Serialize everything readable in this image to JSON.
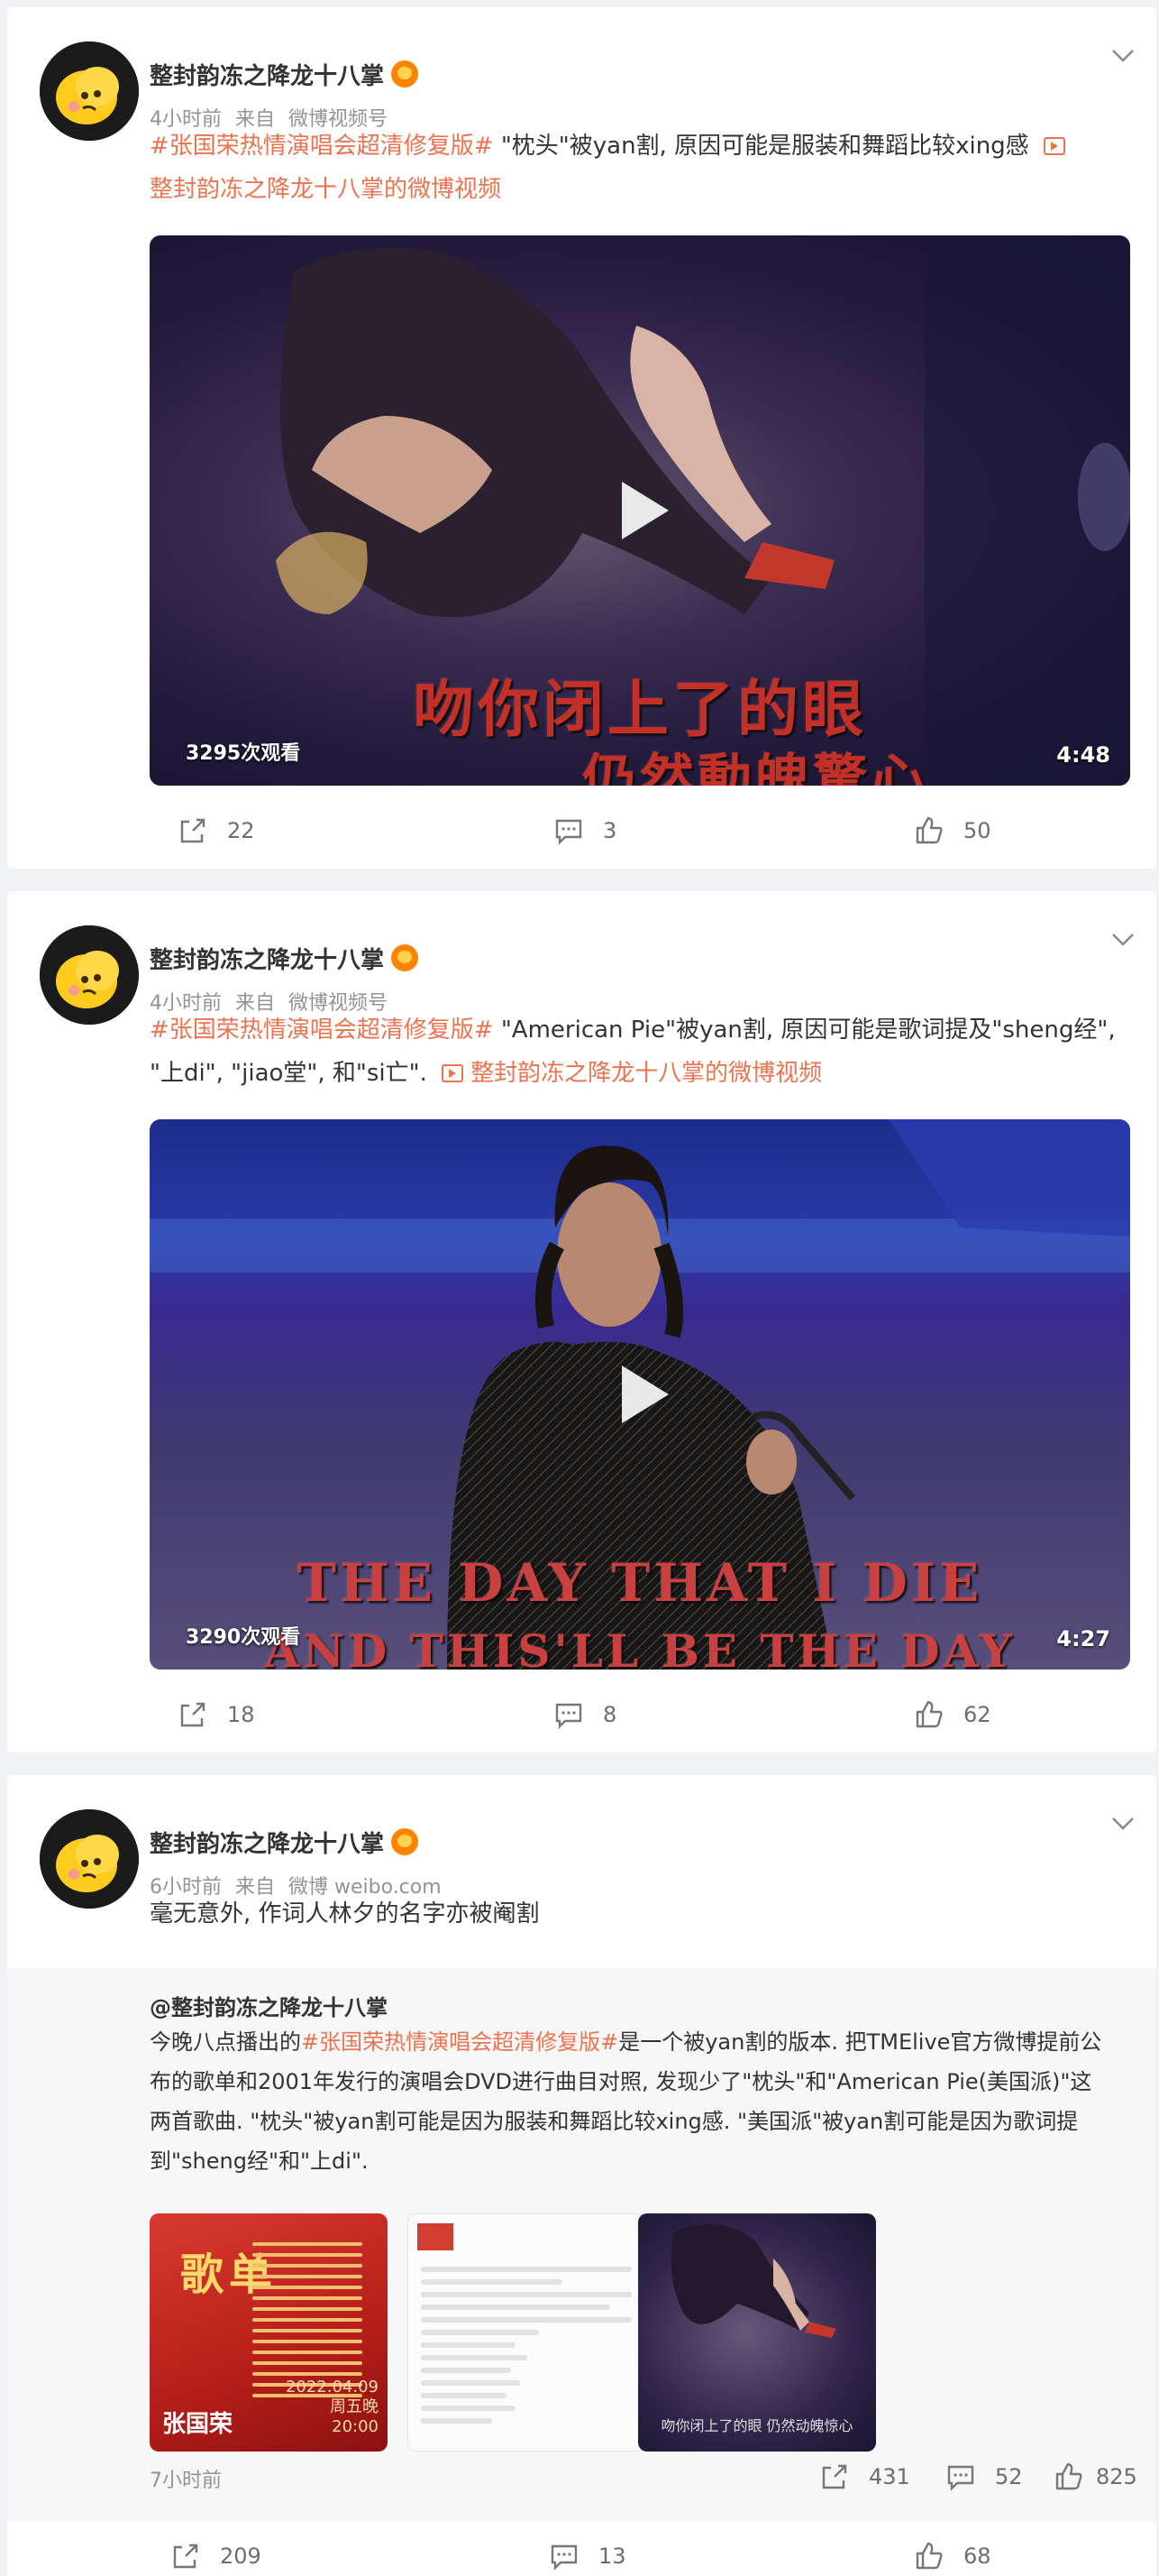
{
  "posts": [
    {
      "username": "整封韵冻之降龙十八掌",
      "time": "4小时前",
      "source_prefix": "来自",
      "source": "微博视频号",
      "hashtag": "#张国荣热情演唱会超清修复版#",
      "text": " \"枕头\"被yan割, 原因可能是服装和舞蹈比较xing感 ",
      "video_link": "整封韵冻之降龙十八掌的微博视频",
      "video": {
        "views": "3295次观看",
        "duration": "4:48",
        "subtitle_line1": "吻你闭上了的眼",
        "subtitle_line2": "仍然動魄驚心"
      },
      "actions": {
        "repost": "22",
        "comment": "3",
        "like": "50"
      }
    },
    {
      "username": "整封韵冻之降龙十八掌",
      "time": "4小时前",
      "source_prefix": "来自",
      "source": "微博视频号",
      "hashtag": "#张国荣热情演唱会超清修复版#",
      "text": " \"American Pie\"被yan割, 原因可能是歌词提及\"sheng经\", \"上di\", \"jiao堂\", 和\"si亡\". ",
      "video_link": "整封韵冻之降龙十八掌的微博视频",
      "video": {
        "views": "3290次观看",
        "duration": "4:27",
        "subtitle_line1": "THE DAY THAT I DIE",
        "subtitle_line2": "AND THIS'LL BE THE DAY"
      },
      "actions": {
        "repost": "18",
        "comment": "8",
        "like": "62"
      }
    },
    {
      "username": "整封韵冻之降龙十八掌",
      "time": "6小时前",
      "source_prefix": "来自",
      "source": "微博 weibo.com",
      "text": "毫无意外, 作词人林夕的名字亦被阉割",
      "retweet": {
        "user": "@整封韵冻之降龙十八掌",
        "text_before": "今晚八点播出的",
        "hashtag": "#张国荣热情演唱会超清修复版#",
        "text_after": "是一个被yan割的版本. 把TMElive官方微博提前公布的歌单和2001年发行的演唱会DVD进行曲目对照, 发现少了\"枕头\"和\"American Pie(美国派)\"这两首歌曲. \"枕头\"被yan割可能是因为服装和舞蹈比较xing感. \"美国派\"被yan割可能是因为歌词提到\"sheng经\"和\"上di\".",
        "thumb1_title": "歌单",
        "thumb1_name": "张国荣",
        "thumb1_date": "2022.04.09 周五晚 20:00",
        "thumb3_sub": "吻你闭上了的眼 仍然动魄惊心",
        "time": "7小时前",
        "actions": {
          "repost": "431",
          "comment": "52",
          "like": "825"
        }
      },
      "actions": {
        "repost": "209",
        "comment": "13",
        "like": "68"
      }
    }
  ],
  "colors": {
    "accent": "#eb7350",
    "background": "#f1f2f5",
    "meta": "#939393"
  }
}
